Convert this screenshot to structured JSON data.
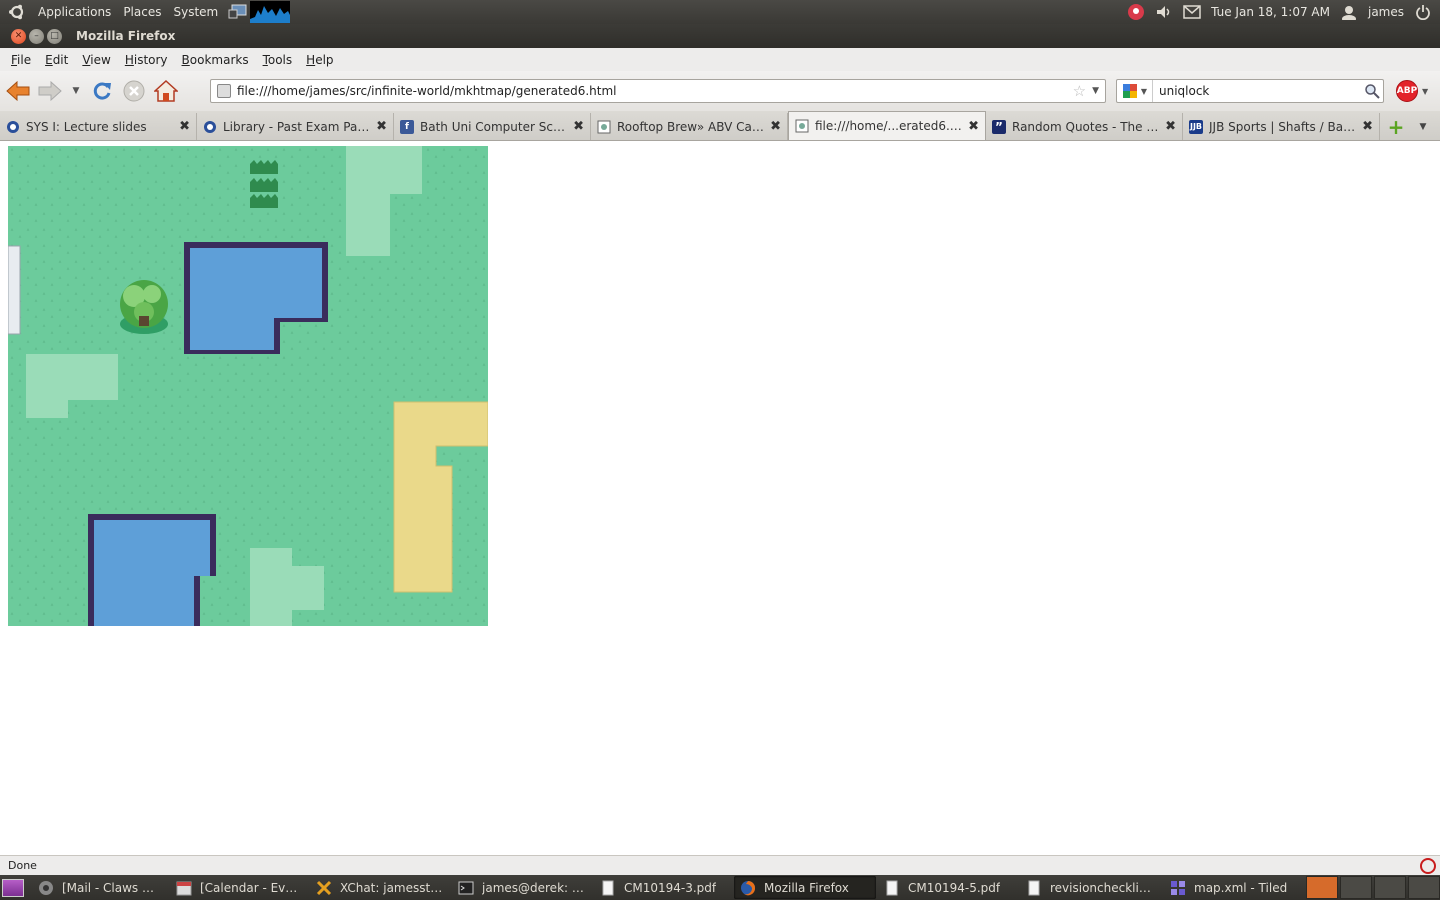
{
  "top_panel": {
    "menus": [
      "Applications",
      "Places",
      "System"
    ],
    "clock": "Tue Jan 18,  1:07 AM",
    "user": "james"
  },
  "window": {
    "title": "Mozilla Firefox"
  },
  "menubar": {
    "items": [
      {
        "label": "File",
        "access": "F",
        "rest": "ile"
      },
      {
        "label": "Edit",
        "access": "E",
        "rest": "dit"
      },
      {
        "label": "View",
        "access": "V",
        "rest": "iew"
      },
      {
        "label": "History",
        "access": "H",
        "rest": "istory"
      },
      {
        "label": "Bookmarks",
        "access": "B",
        "rest": "ookmarks"
      },
      {
        "label": "Tools",
        "access": "T",
        "rest": "ools"
      },
      {
        "label": "Help",
        "access": "H",
        "rest": "elp"
      }
    ]
  },
  "navbar": {
    "url": "file:///home/james/src/infinite-world/mkhtmap/generated6.html",
    "search_query": "uniqlock",
    "adblock_label": "ABP"
  },
  "tabs": [
    {
      "label": "SYS I: Lecture slides",
      "icon": "bath-uni-icon",
      "active": false
    },
    {
      "label": "Library - Past Exam Papers",
      "icon": "bath-uni-icon",
      "active": false
    },
    {
      "label": "Bath Uni Computer Scien...",
      "icon": "facebook-icon",
      "active": false
    },
    {
      "label": "Rooftop Brew» ABV Calc...",
      "icon": "page-icon",
      "active": false
    },
    {
      "label": "file:///home/...erated6.html",
      "icon": "page-icon",
      "active": true
    },
    {
      "label": "Random Quotes - The Qu...",
      "icon": "quote-icon",
      "active": false
    },
    {
      "label": "JJB Sports | Shafts / Barrels",
      "icon": "jjb-icon",
      "active": false
    }
  ],
  "status": {
    "text": "Done"
  },
  "taskbar": {
    "tasks": [
      {
        "label": "[Mail - Claws Mail...",
        "icon": "mail-icon",
        "active": false
      },
      {
        "label": "[Calendar - Evolut...",
        "icon": "calendar-icon",
        "active": false
      },
      {
        "label": "XChat: jamesstanl...",
        "icon": "xchat-icon",
        "active": false
      },
      {
        "label": "james@derek: ~/s...",
        "icon": "terminal-icon",
        "active": false
      },
      {
        "label": "CM10194-3.pdf",
        "icon": "document-icon",
        "active": false
      },
      {
        "label": "Mozilla Firefox",
        "icon": "firefox-icon",
        "active": true
      },
      {
        "label": "CM10194-5.pdf",
        "icon": "document-icon",
        "active": false
      },
      {
        "label": "revisionchecklist.pdf",
        "icon": "document-icon",
        "active": false
      },
      {
        "label": "map.xml - Tiled",
        "icon": "tiled-icon",
        "active": false
      }
    ]
  },
  "map_colors": {
    "grass": "#6ccb9c",
    "light_grass": "#9adcb8",
    "water": "#5e9fd8",
    "shore": "#3a2c5c",
    "sand": "#ead98a"
  }
}
